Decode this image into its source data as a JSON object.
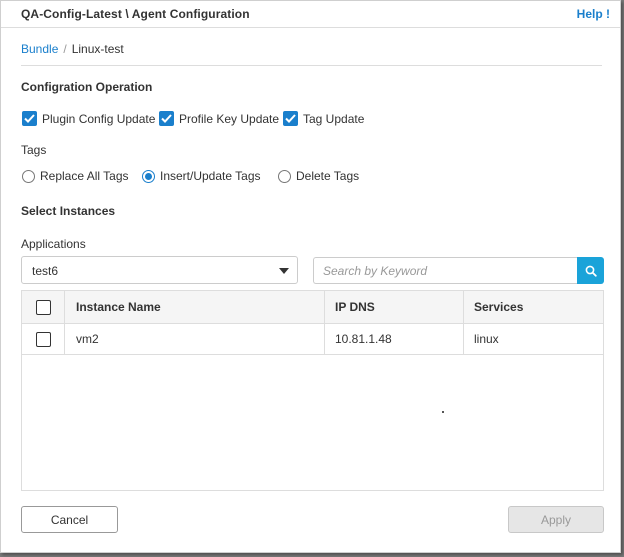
{
  "dialog": {
    "title": "QA-Config-Latest \\ Agent Configuration",
    "help_label": "Help !"
  },
  "breadcrumb": {
    "parent": "Bundle",
    "separator": "/",
    "current": "Linux-test"
  },
  "config_operation": {
    "heading": "Configration Operation",
    "options": [
      {
        "label": "Plugin Config Update",
        "checked": true
      },
      {
        "label": "Profile Key Update",
        "checked": true
      },
      {
        "label": "Tag Update",
        "checked": true
      }
    ]
  },
  "tags": {
    "heading": "Tags",
    "options": [
      {
        "label": "Replace All Tags",
        "selected": false
      },
      {
        "label": "Insert/Update Tags",
        "selected": true
      },
      {
        "label": "Delete Tags",
        "selected": false
      }
    ]
  },
  "instances": {
    "heading": "Select Instances",
    "applications_label": "Applications",
    "application_selected": "test6",
    "search_placeholder": "Search by Keyword",
    "search_value": "",
    "columns": [
      "Instance Name",
      "IP DNS",
      "Services"
    ],
    "rows": [
      {
        "checked": false,
        "instance_name": "vm2",
        "ip_dns": "10.81.1.48",
        "services": "linux"
      }
    ]
  },
  "footer": {
    "cancel_label": "Cancel",
    "apply_label": "Apply",
    "apply_disabled": true
  },
  "colors": {
    "accent": "#1a7fcc",
    "search_button": "#1aa3d9",
    "disabled_button": "#e6e6e6"
  },
  "icons": {
    "checked": "checkmark-icon",
    "search": "search-icon",
    "dropdown": "caret-down-icon"
  }
}
